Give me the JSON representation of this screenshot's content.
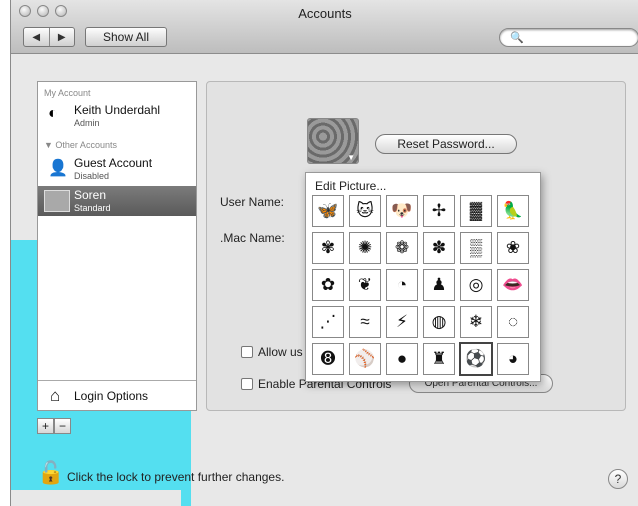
{
  "window": {
    "title": "Accounts"
  },
  "toolbar": {
    "back_label": "◀",
    "forward_label": "▶",
    "show_all_label": "Show All",
    "search_placeholder": ""
  },
  "sidebar": {
    "my_account_header": "My Account",
    "other_accounts_header": "Other Accounts",
    "accounts": [
      {
        "name": "Keith Underdahl",
        "role": "Admin"
      },
      {
        "name": "Guest Account",
        "role": "Disabled"
      },
      {
        "name": "Soren",
        "role": "Standard"
      }
    ],
    "login_options_label": "Login Options",
    "add_label": "+",
    "remove_label": "−"
  },
  "panel": {
    "reset_password_label": "Reset Password...",
    "user_name_label": "User Name:",
    "mac_name_label": ".Mac Name:",
    "allow_label": "Allow us",
    "parental_label": "Enable Parental Controls",
    "open_parental_label": "Open Parental Controls..."
  },
  "picture_popup": {
    "edit_label": "Edit Picture...",
    "tiles": [
      {
        "icon": "butterfly-icon",
        "glyph": "🦋"
      },
      {
        "icon": "cat-icon",
        "glyph": "🐱"
      },
      {
        "icon": "dog-icon",
        "glyph": "🐶"
      },
      {
        "icon": "dragonfly-icon",
        "glyph": "✢"
      },
      {
        "icon": "leopard-icon",
        "glyph": "▓"
      },
      {
        "icon": "parrot-icon",
        "glyph": "🦜"
      },
      {
        "icon": "flower-icon",
        "glyph": "✾"
      },
      {
        "icon": "sunflower-icon",
        "glyph": "✺"
      },
      {
        "icon": "rose-icon",
        "glyph": "❁"
      },
      {
        "icon": "dandelion-icon",
        "glyph": "✽"
      },
      {
        "icon": "zebra-icon",
        "glyph": "▒"
      },
      {
        "icon": "petal-icon",
        "glyph": "❀"
      },
      {
        "icon": "daisy-icon",
        "glyph": "✿"
      },
      {
        "icon": "leaf-icon",
        "glyph": "❦"
      },
      {
        "icon": "fortune-cookie-icon",
        "glyph": "◔"
      },
      {
        "icon": "gingerbread-icon",
        "glyph": "♟"
      },
      {
        "icon": "target-icon",
        "glyph": "◎"
      },
      {
        "icon": "lips-icon",
        "glyph": "👄"
      },
      {
        "icon": "grass-icon",
        "glyph": "⋰"
      },
      {
        "icon": "water-icon",
        "glyph": "≈"
      },
      {
        "icon": "lightning-icon",
        "glyph": "⚡"
      },
      {
        "icon": "eggs-icon",
        "glyph": "◍"
      },
      {
        "icon": "snowflake-icon",
        "glyph": "❄"
      },
      {
        "icon": "sand-icon",
        "glyph": "◌"
      },
      {
        "icon": "eight-ball-icon",
        "glyph": "➑"
      },
      {
        "icon": "baseball-icon",
        "glyph": "⚾"
      },
      {
        "icon": "basketball-icon",
        "glyph": "●"
      },
      {
        "icon": "bowling-icon",
        "glyph": "♜"
      },
      {
        "icon": "soccer-ball-icon",
        "glyph": "⚽"
      },
      {
        "icon": "tennis-ball-icon",
        "glyph": "◕"
      }
    ],
    "selected_index": 28
  },
  "footer": {
    "lock_message": "Click the lock to prevent further changes.",
    "help_label": "?"
  }
}
